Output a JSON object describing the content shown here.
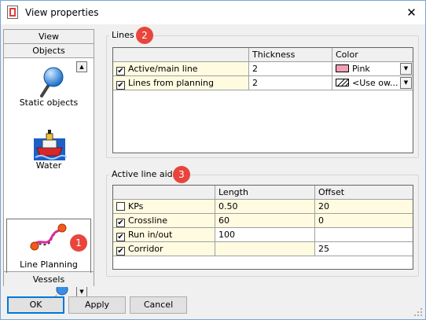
{
  "window": {
    "title": "View properties"
  },
  "sidebar": {
    "headers_top": [
      "View",
      "Objects"
    ],
    "items": [
      {
        "label": "Static objects",
        "icon": "static-objects-icon"
      },
      {
        "label": "Water",
        "icon": "water-ship-icon"
      },
      {
        "label": "Line Planning",
        "icon": "line-planning-icon",
        "selected": true
      }
    ],
    "header_bottom": "Vessels"
  },
  "lines": {
    "title": "Lines",
    "columns": [
      "",
      "Thickness",
      "Color"
    ],
    "rows": [
      {
        "checked": true,
        "name": "Active/main line",
        "thickness": "2",
        "color_label": "Pink",
        "color": "#f4a0b4"
      },
      {
        "checked": true,
        "name": "Lines from planning",
        "thickness": "2",
        "color_label": "<Use ow..."
      }
    ]
  },
  "line_aids": {
    "title": "Active line aids",
    "columns": [
      "",
      "Length",
      "Offset"
    ],
    "rows": [
      {
        "checked": false,
        "name": "KPs",
        "length": "0.50",
        "offset": "20",
        "highlight": true
      },
      {
        "checked": true,
        "name": "Crossline",
        "length": "60",
        "offset": "0",
        "highlight": true
      },
      {
        "checked": true,
        "name": "Run in/out",
        "length": "100",
        "offset": "",
        "highlight": false
      },
      {
        "checked": true,
        "name": "Corridor",
        "length": "",
        "offset": "25",
        "highlight": true
      }
    ]
  },
  "badges": [
    "1",
    "2",
    "3"
  ],
  "buttons": {
    "ok": "OK",
    "apply": "Apply",
    "cancel": "Cancel"
  },
  "colors": {
    "badge": "#e8453c",
    "highlight_row": "#fffbe1",
    "accent": "#0078d7"
  }
}
